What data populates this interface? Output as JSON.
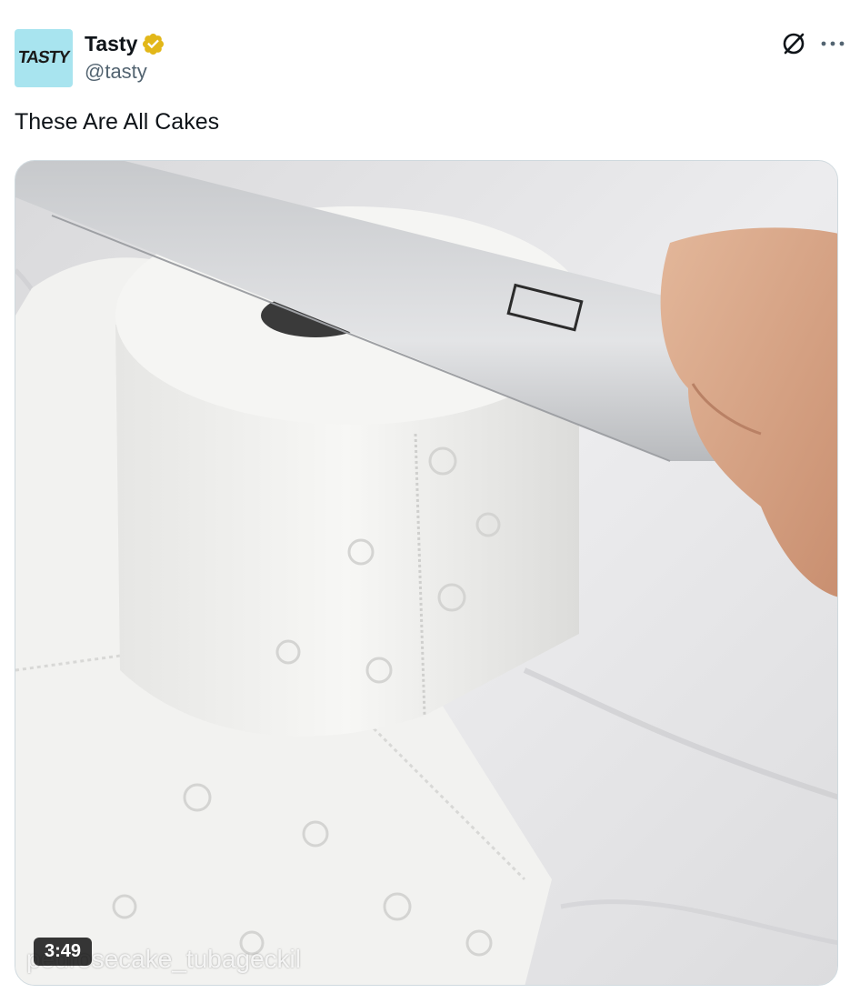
{
  "author": {
    "avatar_text": "TASTY",
    "display_name": "Tasty",
    "handle": "@tasty",
    "verified_color": "#e2b719"
  },
  "actions": {
    "grok_icon": "grok-icon",
    "more_icon": "more-icon"
  },
  "tweet": {
    "text": "These Are All Cakes"
  },
  "media": {
    "duration": "3:49",
    "watermark": "pedrosecake_tubageckil"
  },
  "colors": {
    "text": "#0f1419",
    "secondary": "#536471",
    "avatar_bg": "#a8e4ef"
  }
}
